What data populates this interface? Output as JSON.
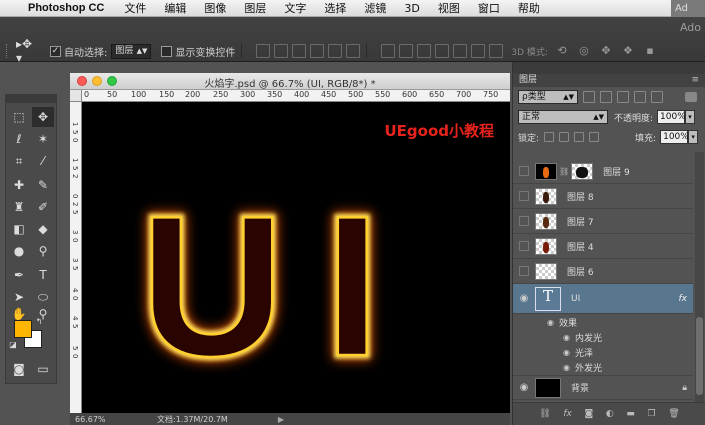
{
  "menubar": {
    "app_name": "Photoshop CC",
    "menus": [
      "文件",
      "编辑",
      "图像",
      "图层",
      "文字",
      "选择",
      "滤镜",
      "3D",
      "视图",
      "窗口",
      "帮助"
    ],
    "right_cut": "Ad"
  },
  "options": {
    "app_title": "Ado",
    "auto_select_label": "自动选择:",
    "auto_select_value": "图层",
    "show_transform_label": "显示变换控件",
    "mode_3d_label": "3D 模式:"
  },
  "document": {
    "title": "火焰字.psd @ 66.7% (UI, RGB/8*) *",
    "ruler_ticks": [
      "0",
      "50",
      "100",
      "150",
      "200",
      "250",
      "300",
      "350",
      "400",
      "450",
      "500",
      "550",
      "600",
      "650",
      "700",
      "750"
    ],
    "left_ruler_ticks": [
      "1",
      "5",
      "0",
      "1",
      "5",
      "2",
      "0",
      "2",
      "5",
      "3",
      "0",
      "3",
      "5",
      "4",
      "0",
      "4",
      "5",
      "5",
      "0"
    ],
    "canvas_text": "UI",
    "watermark": "UEgood小教程",
    "zoom_status": "66.67%",
    "doc_status": "文档:1.37M/20.7M"
  },
  "layers_panel": {
    "title": "图层",
    "kind_label": "ρ类型",
    "blend_mode": "正常",
    "opacity_label": "不透明度:",
    "opacity_value": "100%",
    "lock_label": "锁定:",
    "fill_label": "填充:",
    "fill_value": "100%",
    "layers": [
      {
        "name": "图层 9"
      },
      {
        "name": "图层 8"
      },
      {
        "name": "图层 7"
      },
      {
        "name": "图层 4"
      },
      {
        "name": "图层 6"
      },
      {
        "name": "UI",
        "fx": "fx"
      },
      {
        "name": "背景"
      }
    ],
    "effects_label": "效果",
    "effects": [
      "内发光",
      "光泽",
      "外发光"
    ],
    "footer_icons": [
      "link-icon",
      "fx-icon",
      "mask-icon",
      "adjustment-icon",
      "group-icon",
      "new-layer-icon",
      "trash-icon"
    ]
  },
  "colors": {
    "foreground": "#ffb600",
    "background": "#ffffff",
    "glow_inner": "#ffe35a",
    "glow_outer": "#ff4400",
    "watermark": "#e8231c",
    "selected_layer": "#59768f"
  }
}
